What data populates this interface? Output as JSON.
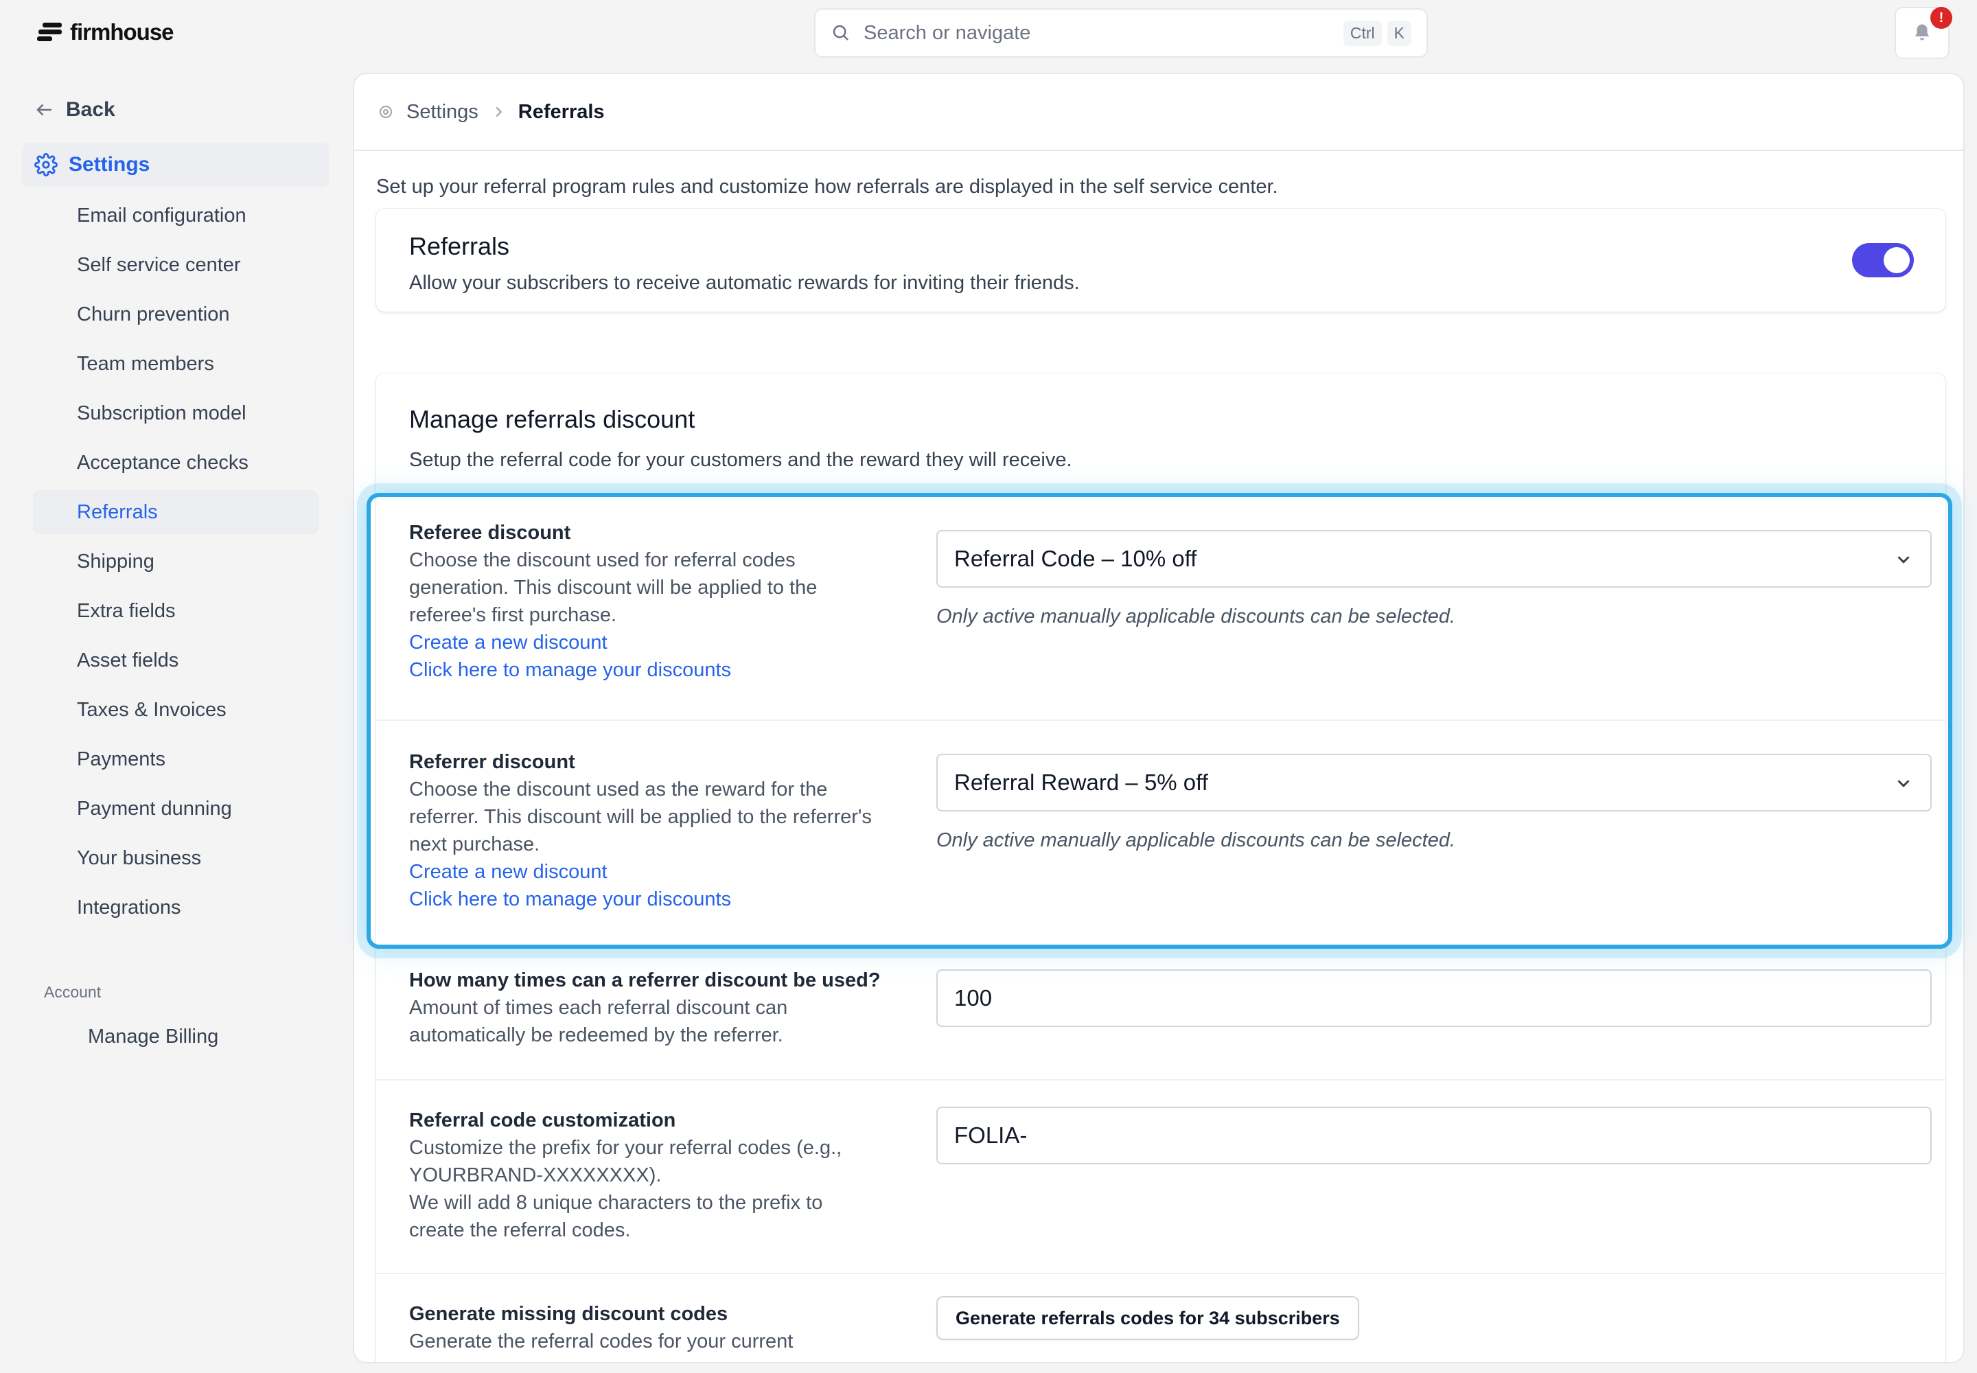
{
  "brand": {
    "name": "firmhouse"
  },
  "search": {
    "placeholder": "Search or navigate",
    "shortcut_ctrl": "Ctrl",
    "shortcut_key": "K"
  },
  "notifications": {
    "badge": "!"
  },
  "sidebar": {
    "back_label": "Back",
    "settings_label": "Settings",
    "items": [
      {
        "label": "Email configuration"
      },
      {
        "label": "Self service center"
      },
      {
        "label": "Churn prevention"
      },
      {
        "label": "Team members"
      },
      {
        "label": "Subscription model"
      },
      {
        "label": "Acceptance checks"
      },
      {
        "label": "Referrals"
      },
      {
        "label": "Shipping"
      },
      {
        "label": "Extra fields"
      },
      {
        "label": "Asset fields"
      },
      {
        "label": "Taxes & Invoices"
      },
      {
        "label": "Payments"
      },
      {
        "label": "Payment dunning"
      },
      {
        "label": "Your business"
      },
      {
        "label": "Integrations"
      }
    ],
    "active_item": "Referrals",
    "account_heading": "Account",
    "manage_billing": "Manage Billing"
  },
  "breadcrumb": {
    "parent": "Settings",
    "current": "Referrals"
  },
  "intro": "Set up your referral program rules and customize how referrals are displayed in the self service center.",
  "referrals_card": {
    "title": "Referrals",
    "description": "Allow your subscribers to receive automatic rewards for inviting their friends.",
    "enabled": true
  },
  "discount_card": {
    "title": "Manage referrals discount",
    "description": "Setup the referral code for your customers and the reward they will receive.",
    "referee": {
      "label": "Referee discount",
      "line1": "Choose the discount used for referral codes",
      "line2": "generation. This discount will be applied to the",
      "line3": "referee's first purchase.",
      "create_link": "Create a new discount",
      "manage_link": "Click here to manage your discounts",
      "selected": "Referral Code – 10% off",
      "hint": "Only active manually applicable discounts can be selected."
    },
    "referrer": {
      "label": "Referrer discount",
      "line1": "Choose the discount used as the reward for the",
      "line2": "referrer. This discount will be applied to the referrer's",
      "line3": "next purchase.",
      "create_link": "Create a new discount",
      "manage_link": "Click here to manage your discounts",
      "selected": "Referral Reward – 5% off",
      "hint": "Only active manually applicable discounts can be selected."
    },
    "usage": {
      "label": "How many times can a referrer discount be used?",
      "line1": "Amount of times each referral discount can",
      "line2": "automatically be redeemed by the referrer.",
      "value": "100"
    },
    "code_custom": {
      "label": "Referral code customization",
      "line1": "Customize the prefix for your referral codes (e.g.,",
      "line2": "YOURBRAND-XXXXXXXX).",
      "line3": "We will add 8 unique characters to the prefix to",
      "line4": "create the referral codes.",
      "value": "FOLIA-"
    },
    "generate": {
      "label": "Generate missing discount codes",
      "line1": "Generate the referral codes for your current",
      "button": "Generate referrals codes for 34 subscribers"
    }
  },
  "colors": {
    "accent": "#2563eb",
    "toggle": "#4f46e5",
    "highlight": "#2ba7e3",
    "badge": "#dc2626"
  }
}
